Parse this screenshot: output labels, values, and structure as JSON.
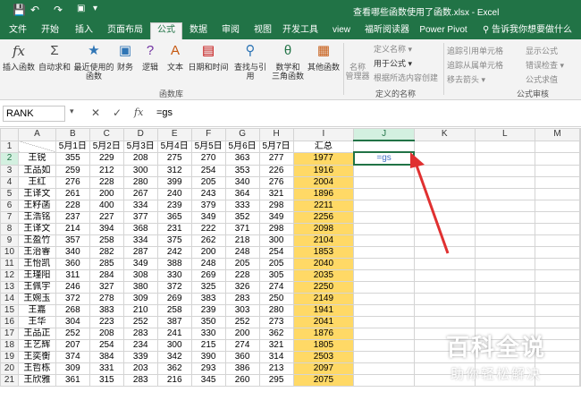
{
  "titlebar": {
    "title": "查看哪些函数使用了函数.xlsx - Excel",
    "save_icon": "save-icon",
    "undo_icon": "undo-icon",
    "redo_icon": "redo-icon"
  },
  "tabs": [
    "文件",
    "开始",
    "插入",
    "页面布局",
    "公式",
    "数据",
    "审阅",
    "视图",
    "开发工具",
    "view",
    "福昕阅读器",
    "Power Pivot",
    "告诉我你想要做什么"
  ],
  "active_tab": "公式",
  "ribbon": {
    "function_library": {
      "label": "函数库",
      "buttons": [
        "插入函数",
        "自动求和",
        "最近使用的\n函数",
        "财务",
        "逻辑",
        "文本",
        "日期和时间",
        "查找与引用",
        "数学和\n三角函数",
        "其他函数"
      ]
    },
    "defined_names": {
      "label": "定义的名称",
      "name_manager": "名称\n管理器",
      "items": [
        "定义名称 ▾",
        "用于公式 ▾",
        "根据所选内容创建"
      ]
    },
    "formula_auditing": {
      "label": "公式审核",
      "items": [
        "追踪引用单元格",
        "追踪从属单元格",
        "移去箭头 ▾",
        "显示公式",
        "错误检查 ▾",
        "公式求值"
      ]
    }
  },
  "formula_bar": {
    "name_box": "RANK",
    "content": "=gs"
  },
  "sheet": {
    "columns": [
      "A",
      "B",
      "C",
      "D",
      "E",
      "F",
      "G",
      "H",
      "I",
      "J",
      "K",
      "L",
      "M"
    ],
    "header_row": [
      "",
      "5月1日",
      "5月2日",
      "5月3日",
      "5月4日",
      "5月5日",
      "5月6日",
      "5月7日",
      "汇总",
      "",
      "",
      "",
      ""
    ],
    "rows": [
      [
        "王锐",
        "355",
        "229",
        "208",
        "275",
        "270",
        "363",
        "277",
        "1977"
      ],
      [
        "王品如",
        "259",
        "212",
        "300",
        "312",
        "254",
        "353",
        "226",
        "1916"
      ],
      [
        "王红",
        "276",
        "228",
        "280",
        "399",
        "205",
        "340",
        "276",
        "2004"
      ],
      [
        "王译文",
        "261",
        "200",
        "267",
        "240",
        "243",
        "364",
        "321",
        "1896"
      ],
      [
        "王籽菡",
        "228",
        "400",
        "334",
        "239",
        "379",
        "333",
        "298",
        "2211"
      ],
      [
        "王浩铭",
        "237",
        "227",
        "377",
        "365",
        "349",
        "352",
        "349",
        "2256"
      ],
      [
        "王译文",
        "214",
        "394",
        "368",
        "231",
        "222",
        "371",
        "298",
        "2098"
      ],
      [
        "王盈竹",
        "357",
        "258",
        "334",
        "375",
        "262",
        "218",
        "300",
        "2104"
      ],
      [
        "王治睿",
        "340",
        "282",
        "287",
        "242",
        "200",
        "248",
        "254",
        "1853"
      ],
      [
        "王怡凯",
        "360",
        "285",
        "349",
        "388",
        "248",
        "205",
        "205",
        "2040"
      ],
      [
        "王瑾阳",
        "311",
        "284",
        "308",
        "330",
        "269",
        "228",
        "305",
        "2035"
      ],
      [
        "王佩宇",
        "246",
        "327",
        "380",
        "372",
        "325",
        "326",
        "274",
        "2250"
      ],
      [
        "王婉玉",
        "372",
        "278",
        "309",
        "269",
        "383",
        "283",
        "250",
        "2149"
      ],
      [
        "王嘉",
        "268",
        "383",
        "210",
        "258",
        "239",
        "303",
        "280",
        "1941"
      ],
      [
        "王华",
        "304",
        "223",
        "252",
        "387",
        "350",
        "252",
        "273",
        "2041"
      ],
      [
        "王品正",
        "252",
        "208",
        "283",
        "241",
        "330",
        "200",
        "362",
        "1876"
      ],
      [
        "王艺辉",
        "207",
        "254",
        "234",
        "300",
        "215",
        "274",
        "321",
        "1805"
      ],
      [
        "王奕衡",
        "374",
        "384",
        "339",
        "342",
        "390",
        "360",
        "314",
        "2503"
      ],
      [
        "王哲栋",
        "309",
        "331",
        "203",
        "362",
        "293",
        "386",
        "213",
        "2097"
      ],
      [
        "王欣雅",
        "361",
        "315",
        "283",
        "216",
        "345",
        "260",
        "295",
        "2075"
      ]
    ],
    "active_cell_text": "=gs",
    "highlight_color": "#ffd966",
    "accent_color": "#217346"
  },
  "watermark": {
    "line1": "百科全说",
    "line2": "助你轻松解决"
  }
}
